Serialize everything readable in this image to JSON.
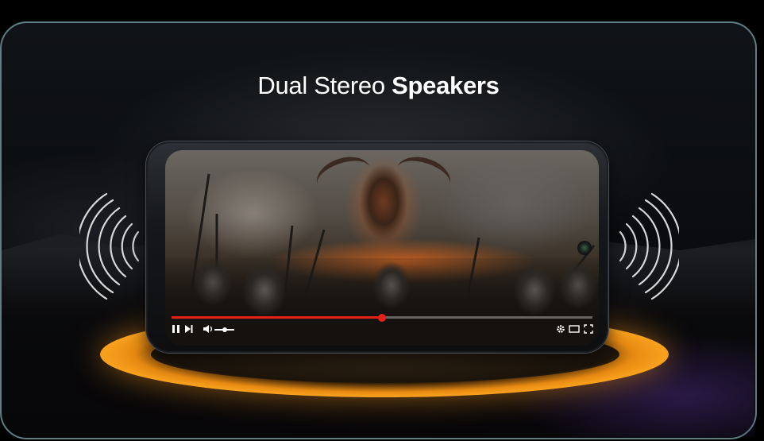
{
  "headline": {
    "light": "Dual Stereo",
    "bold": "Speakers"
  },
  "video_player": {
    "progress": 0.5,
    "volume": 0.5,
    "controls": {
      "pause_icon": "pause-icon",
      "next_icon": "next-icon",
      "volume_icon": "volume-icon",
      "settings_icon": "gear-icon",
      "theater_icon": "theater-mode-icon",
      "fullscreen_icon": "fullscreen-icon"
    },
    "accent_color": "#e62117"
  },
  "colors": {
    "frame_border": "#5c7f83",
    "glow": "#f9a11e"
  },
  "icons": [
    "sound-waves-left-icon",
    "sound-waves-right-icon"
  ]
}
